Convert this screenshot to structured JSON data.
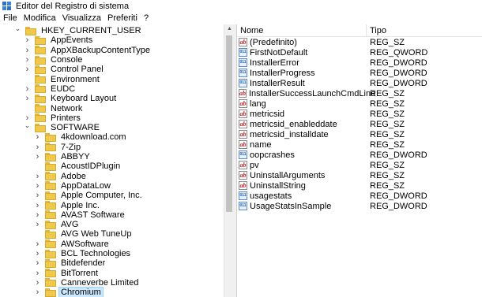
{
  "window": {
    "title": "Editor del Registro di sistema",
    "icon": "registry-editor-icon"
  },
  "menu": [
    "File",
    "Modifica",
    "Visualizza",
    "Preferiti",
    "?"
  ],
  "tree": {
    "root": {
      "label": "HKEY_CURRENT_USER",
      "expanded": true
    },
    "items": [
      {
        "label": "AppEvents",
        "level": 1,
        "expanded": false
      },
      {
        "label": "AppXBackupContentType",
        "level": 1,
        "expanded": false
      },
      {
        "label": "Console",
        "level": 1,
        "expanded": false
      },
      {
        "label": "Control Panel",
        "level": 1,
        "expanded": false
      },
      {
        "label": "Environment",
        "level": 1,
        "expanded": null
      },
      {
        "label": "EUDC",
        "level": 1,
        "expanded": false
      },
      {
        "label": "Keyboard Layout",
        "level": 1,
        "expanded": false
      },
      {
        "label": "Network",
        "level": 1,
        "expanded": null
      },
      {
        "label": "Printers",
        "level": 1,
        "expanded": false
      },
      {
        "label": "SOFTWARE",
        "level": 1,
        "expanded": true
      },
      {
        "label": "4kdownload.com",
        "level": 2,
        "expanded": false
      },
      {
        "label": "7-Zip",
        "level": 2,
        "expanded": false
      },
      {
        "label": "ABBYY",
        "level": 2,
        "expanded": false
      },
      {
        "label": "AcoustIDPlugin",
        "level": 2,
        "expanded": null
      },
      {
        "label": "Adobe",
        "level": 2,
        "expanded": false
      },
      {
        "label": "AppDataLow",
        "level": 2,
        "expanded": false
      },
      {
        "label": "Apple Computer, Inc.",
        "level": 2,
        "expanded": false
      },
      {
        "label": "Apple Inc.",
        "level": 2,
        "expanded": false
      },
      {
        "label": "AVAST Software",
        "level": 2,
        "expanded": false
      },
      {
        "label": "AVG",
        "level": 2,
        "expanded": false
      },
      {
        "label": "AVG Web TuneUp",
        "level": 2,
        "expanded": null
      },
      {
        "label": "AWSoftware",
        "level": 2,
        "expanded": false
      },
      {
        "label": "BCL Technologies",
        "level": 2,
        "expanded": false
      },
      {
        "label": "Bitdefender",
        "level": 2,
        "expanded": false
      },
      {
        "label": "BitTorrent",
        "level": 2,
        "expanded": false
      },
      {
        "label": "Canneverbe Limited",
        "level": 2,
        "expanded": false
      },
      {
        "label": "Chromium",
        "level": 2,
        "expanded": false,
        "selected": true
      }
    ]
  },
  "list": {
    "headers": {
      "name": "Nome",
      "type": "Tipo"
    },
    "rows": [
      {
        "name": "(Predefinito)",
        "type": "REG_SZ",
        "icon": "string-value-icon"
      },
      {
        "name": "FirstNotDefault",
        "type": "REG_QWORD",
        "icon": "binary-value-icon"
      },
      {
        "name": "InstallerError",
        "type": "REG_DWORD",
        "icon": "binary-value-icon"
      },
      {
        "name": "InstallerProgress",
        "type": "REG_DWORD",
        "icon": "binary-value-icon"
      },
      {
        "name": "InstallerResult",
        "type": "REG_DWORD",
        "icon": "binary-value-icon"
      },
      {
        "name": "InstallerSuccessLaunchCmdLine",
        "type": "REG_SZ",
        "icon": "string-value-icon"
      },
      {
        "name": "lang",
        "type": "REG_SZ",
        "icon": "string-value-icon"
      },
      {
        "name": "metricsid",
        "type": "REG_SZ",
        "icon": "string-value-icon"
      },
      {
        "name": "metricsid_enableddate",
        "type": "REG_SZ",
        "icon": "string-value-icon"
      },
      {
        "name": "metricsid_installdate",
        "type": "REG_SZ",
        "icon": "string-value-icon"
      },
      {
        "name": "name",
        "type": "REG_SZ",
        "icon": "string-value-icon"
      },
      {
        "name": "oopcrashes",
        "type": "REG_DWORD",
        "icon": "binary-value-icon"
      },
      {
        "name": "pv",
        "type": "REG_SZ",
        "icon": "string-value-icon"
      },
      {
        "name": "UninstallArguments",
        "type": "REG_SZ",
        "icon": "string-value-icon"
      },
      {
        "name": "UninstallString",
        "type": "REG_SZ",
        "icon": "string-value-icon"
      },
      {
        "name": "usagestats",
        "type": "REG_DWORD",
        "icon": "binary-value-icon"
      },
      {
        "name": "UsageStatsInSample",
        "type": "REG_DWORD",
        "icon": "binary-value-icon"
      }
    ]
  },
  "colors": {
    "folder": "#f0c94b",
    "selection": "#cce8ff",
    "string_icon": "#c0282d",
    "binary_icon": "#1c5fb8"
  }
}
